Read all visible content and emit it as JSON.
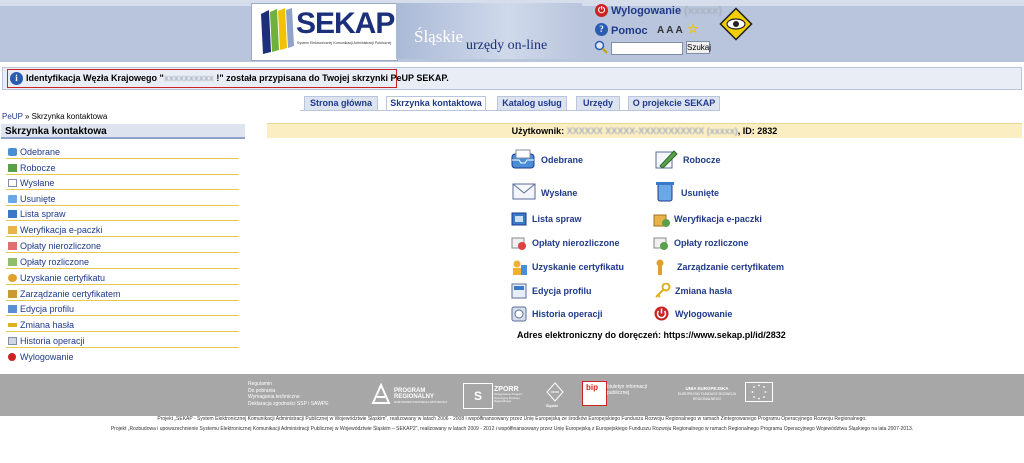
{
  "header": {
    "logo_text": "SEKAP",
    "logo_subtitle": "System Elektronicznej Komunikacji Administracji Publicznej",
    "slogan_top": "Śląskie",
    "slogan_bottom": "urzędy on-line",
    "logout_label": "Wylogowanie",
    "logout_user": "(xxxxx)",
    "help_label": "Pomoc",
    "font_size_controls": "A A A",
    "search_placeholder": "",
    "search_button": "Szukaj"
  },
  "notice": {
    "text_before": "Identyfikacja Węzła Krajowego \"",
    "text_masked": "xxxxxxxxxx",
    "text_after": " !\" została przypisana do Twojej skrzynki PeUP SEKAP."
  },
  "tabs": [
    {
      "label": "Strona główna",
      "active": false
    },
    {
      "label": "Skrzynka kontaktowa",
      "active": true
    },
    {
      "label": "Katalog usług",
      "active": false
    },
    {
      "label": "Urzędy",
      "active": false
    },
    {
      "label": "O projekcie SEKAP",
      "active": false
    }
  ],
  "breadcrumb": {
    "root": "PeUP",
    "sep": " » ",
    "current": "Skrzynka kontaktowa"
  },
  "sidebar": {
    "title": "Skrzynka kontaktowa",
    "items": [
      {
        "label": "Odebrane",
        "icon": "inbox-icon"
      },
      {
        "label": "Robocze",
        "icon": "draft-icon"
      },
      {
        "label": "Wysłane",
        "icon": "sent-icon"
      },
      {
        "label": "Usunięte",
        "icon": "trash-icon"
      },
      {
        "label": "Lista spraw",
        "icon": "case-list-icon"
      },
      {
        "label": "Weryfikacja e-paczki",
        "icon": "package-verify-icon"
      },
      {
        "label": "Opłaty nierozliczone",
        "icon": "unpaid-fees-icon"
      },
      {
        "label": "Opłaty rozliczone",
        "icon": "paid-fees-icon"
      },
      {
        "label": "Uzyskanie certyfikatu",
        "icon": "certificate-get-icon"
      },
      {
        "label": "Zarządzanie certyfikatem",
        "icon": "certificate-manage-icon"
      },
      {
        "label": "Edycja profilu",
        "icon": "profile-edit-icon"
      },
      {
        "label": "Zmiana hasła",
        "icon": "key-icon"
      },
      {
        "label": "Historia operacji",
        "icon": "history-icon"
      },
      {
        "label": "Wylogowanie",
        "icon": "logout-icon"
      }
    ]
  },
  "user_bar": {
    "label": "Użytkownik:",
    "name_masked": "XXXXXX XXXXX-XXXXXXXXXXX",
    "login_masked": "(xxxxx)",
    "id_text": ", ID: 2832"
  },
  "grid": {
    "left": [
      {
        "label": "Odebrane",
        "icon": "inbox-icon"
      },
      {
        "label": "Wysłane",
        "icon": "sent-icon"
      },
      {
        "label": "Lista spraw",
        "icon": "case-list-icon"
      },
      {
        "label": "Opłaty nierozliczone",
        "icon": "unpaid-fees-icon"
      },
      {
        "label": "Uzyskanie certyfikatu",
        "icon": "certificate-get-icon"
      },
      {
        "label": "Edycja profilu",
        "icon": "profile-edit-icon"
      },
      {
        "label": "Historia operacji",
        "icon": "history-icon"
      }
    ],
    "right": [
      {
        "label": "Robocze",
        "icon": "draft-icon"
      },
      {
        "label": "Usunięte",
        "icon": "trash-icon"
      },
      {
        "label": "Weryfikacja e-paczki",
        "icon": "package-verify-icon"
      },
      {
        "label": "Opłaty rozliczone",
        "icon": "paid-fees-icon"
      },
      {
        "label": "Zarządzanie certyfikatem",
        "icon": "certificate-manage-icon"
      },
      {
        "label": "Zmiana hasła",
        "icon": "key-icon"
      },
      {
        "label": "Wylogowanie",
        "icon": "logout-icon"
      }
    ]
  },
  "address": "Adres elektroniczny do doręczeń: https://www.sekap.pl/id/2832",
  "footer": {
    "links": [
      "Regulamin",
      "Do pobrania",
      "Wymagania techniczne",
      "Deklaracja zgodności SSP i SAWPE"
    ],
    "logo_program": "PROGRAM REGIONALNY",
    "logo_program_sub": "NARODOWA STRATEGIA SPÓJNOŚCI",
    "logo_zporr": "ZPORR",
    "logo_zporr_sub": "Zintegrowany Program Operacyjny Rozwoju Regionalnego",
    "logo_slaskie": "Śląskie",
    "logo_bip": "bip",
    "logo_bip_text": "biuletyn informacji publicznej",
    "logo_eu": "UNIA EUROPEJSKA",
    "logo_eu_sub": "EUROPEJSKI FUNDUSZ ROZWOJU REGIONALNEGO",
    "note1": "Projekt „SEKAP - System Elektronicznej Komunikacji Administracji Publicznej w Województwie Śląskim\", realizowany w latach 2006 - 2008 i współfinansowany przez Unię Europejską ze środków Europejskiego Funduszu Rozwoju Regionalnego w ramach Zintegrowanego Programu Operacyjnego Rozwoju Regionalnego.",
    "note2": "Projekt „Rozbudowa i upowszechnienie Systemu Elektronicznej Komunikacji Administracji Publicznej w Województwie Śląskim – SEKAP2\", realizowany w latach 2009 - 2012 i współfinansowany przez Unię Europejską z Europejskiego Funduszu Rozwoju Regionalnego w ramach Regionalnego Programu Operacyjnego Województwa Śląskiego na lata 2007-2013."
  },
  "colors": {
    "accent": "#1f3a8a",
    "header_bg": "#b9c5dc",
    "user_bar_bg": "#fbeec2",
    "footer_bg": "#a7a7a7",
    "notice_border": "#cc2222"
  }
}
